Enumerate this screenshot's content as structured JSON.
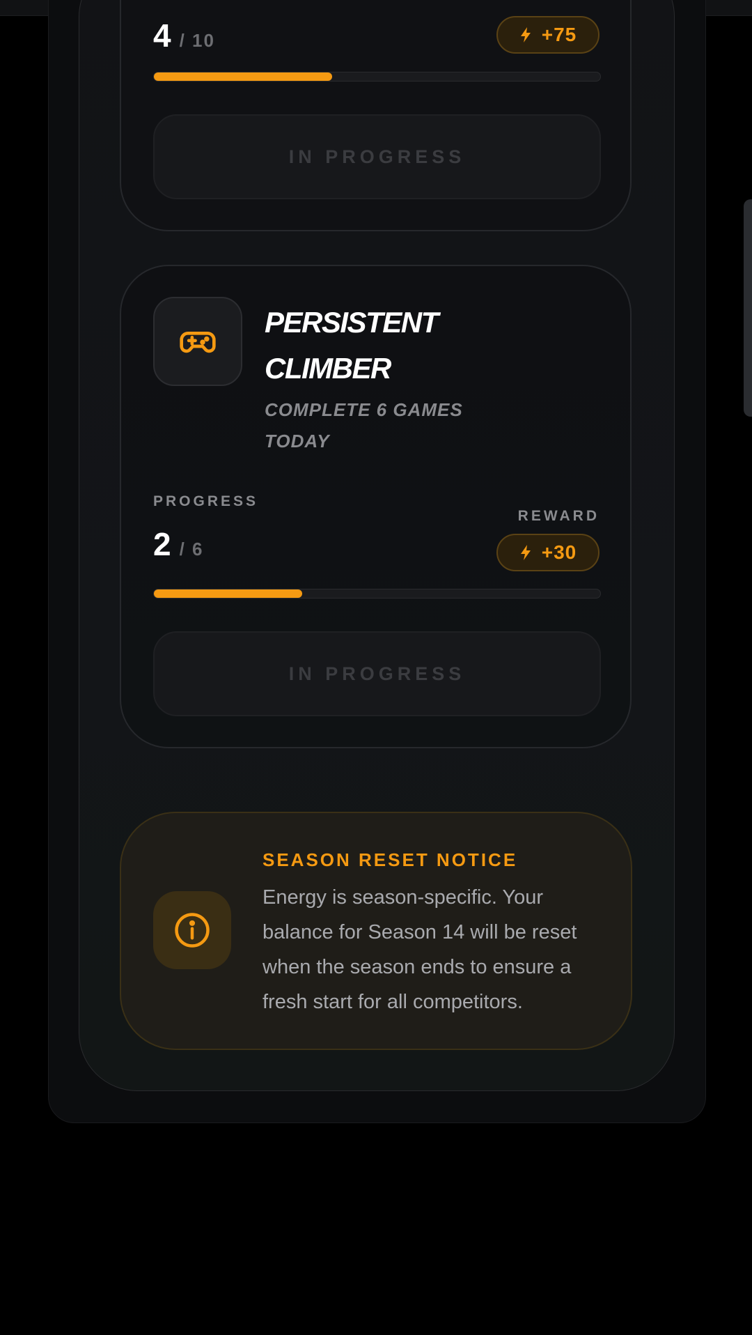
{
  "quests": [
    {
      "current": "4",
      "total": "/ 10",
      "reward": "+75",
      "progress_fraction": 0.4,
      "status_label": "IN PROGRESS"
    },
    {
      "title": "PERSISTENT CLIMBER",
      "description": "COMPLETE 6 GAMES TODAY",
      "icon": "gamepad-icon",
      "progress_label": "PROGRESS",
      "reward_label": "REWARD",
      "current": "2",
      "total": "/ 6",
      "reward": "+30",
      "progress_fraction": 0.333,
      "status_label": "IN PROGRESS"
    }
  ],
  "notice": {
    "title": "SEASON RESET NOTICE",
    "body": "Energy is season-specific. Your balance for Season 14 will be reset when the season ends to ensure a fresh start for all competitors.",
    "icon": "info-icon"
  },
  "colors": {
    "accent": "#f59a12",
    "background": "#000000",
    "card": "#101114"
  }
}
